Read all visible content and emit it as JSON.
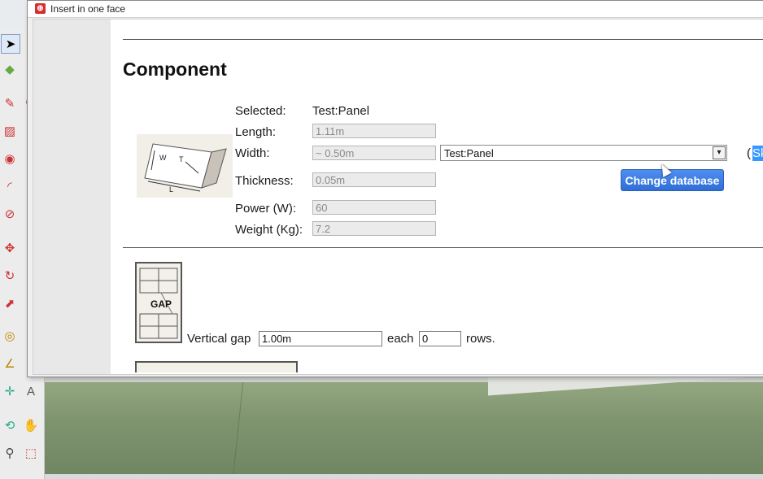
{
  "window": {
    "title": "Insert in one face",
    "app_icon": "sketchup-icon"
  },
  "section": {
    "heading": "Component"
  },
  "component": {
    "selected_label": "Selected:",
    "selected_value": "Test:Panel",
    "length_label": "Length:",
    "length_value": "1.11m",
    "width_label": "Width:",
    "width_value": "~ 0.50m",
    "thickness_label": "Thickness:",
    "thickness_value": "0.05m",
    "power_label": "Power (W):",
    "power_value": "60",
    "weight_label": "Weight (Kg):",
    "weight_value": "7.2"
  },
  "database": {
    "selected_option": "Test:Panel",
    "change_button": "Change database",
    "trailing_paren": "(",
    "trailing_highlight": "Sk"
  },
  "panel_diagram": {
    "labels": [
      "W",
      "T",
      "L"
    ]
  },
  "gap": {
    "diagram_label": "GAP",
    "vertical_gap_label": "Vertical gap",
    "vertical_gap_value": "1.00m",
    "each_label": "each",
    "rows_value": "0",
    "rows_label": "rows."
  },
  "colors": {
    "button": "#2f6fd6",
    "highlight": "#3399ff",
    "ground": "#7f9570"
  }
}
